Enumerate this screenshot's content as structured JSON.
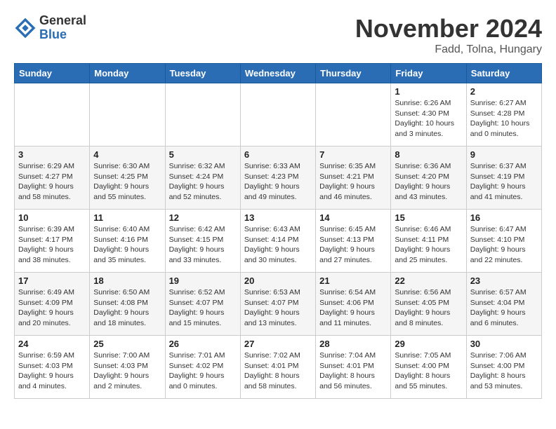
{
  "header": {
    "logo_general": "General",
    "logo_blue": "Blue",
    "month_title": "November 2024",
    "subtitle": "Fadd, Tolna, Hungary"
  },
  "weekdays": [
    "Sunday",
    "Monday",
    "Tuesday",
    "Wednesday",
    "Thursday",
    "Friday",
    "Saturday"
  ],
  "weeks": [
    [
      {
        "day": "",
        "info": ""
      },
      {
        "day": "",
        "info": ""
      },
      {
        "day": "",
        "info": ""
      },
      {
        "day": "",
        "info": ""
      },
      {
        "day": "",
        "info": ""
      },
      {
        "day": "1",
        "info": "Sunrise: 6:26 AM\nSunset: 4:30 PM\nDaylight: 10 hours\nand 3 minutes."
      },
      {
        "day": "2",
        "info": "Sunrise: 6:27 AM\nSunset: 4:28 PM\nDaylight: 10 hours\nand 0 minutes."
      }
    ],
    [
      {
        "day": "3",
        "info": "Sunrise: 6:29 AM\nSunset: 4:27 PM\nDaylight: 9 hours\nand 58 minutes."
      },
      {
        "day": "4",
        "info": "Sunrise: 6:30 AM\nSunset: 4:25 PM\nDaylight: 9 hours\nand 55 minutes."
      },
      {
        "day": "5",
        "info": "Sunrise: 6:32 AM\nSunset: 4:24 PM\nDaylight: 9 hours\nand 52 minutes."
      },
      {
        "day": "6",
        "info": "Sunrise: 6:33 AM\nSunset: 4:23 PM\nDaylight: 9 hours\nand 49 minutes."
      },
      {
        "day": "7",
        "info": "Sunrise: 6:35 AM\nSunset: 4:21 PM\nDaylight: 9 hours\nand 46 minutes."
      },
      {
        "day": "8",
        "info": "Sunrise: 6:36 AM\nSunset: 4:20 PM\nDaylight: 9 hours\nand 43 minutes."
      },
      {
        "day": "9",
        "info": "Sunrise: 6:37 AM\nSunset: 4:19 PM\nDaylight: 9 hours\nand 41 minutes."
      }
    ],
    [
      {
        "day": "10",
        "info": "Sunrise: 6:39 AM\nSunset: 4:17 PM\nDaylight: 9 hours\nand 38 minutes."
      },
      {
        "day": "11",
        "info": "Sunrise: 6:40 AM\nSunset: 4:16 PM\nDaylight: 9 hours\nand 35 minutes."
      },
      {
        "day": "12",
        "info": "Sunrise: 6:42 AM\nSunset: 4:15 PM\nDaylight: 9 hours\nand 33 minutes."
      },
      {
        "day": "13",
        "info": "Sunrise: 6:43 AM\nSunset: 4:14 PM\nDaylight: 9 hours\nand 30 minutes."
      },
      {
        "day": "14",
        "info": "Sunrise: 6:45 AM\nSunset: 4:13 PM\nDaylight: 9 hours\nand 27 minutes."
      },
      {
        "day": "15",
        "info": "Sunrise: 6:46 AM\nSunset: 4:11 PM\nDaylight: 9 hours\nand 25 minutes."
      },
      {
        "day": "16",
        "info": "Sunrise: 6:47 AM\nSunset: 4:10 PM\nDaylight: 9 hours\nand 22 minutes."
      }
    ],
    [
      {
        "day": "17",
        "info": "Sunrise: 6:49 AM\nSunset: 4:09 PM\nDaylight: 9 hours\nand 20 minutes."
      },
      {
        "day": "18",
        "info": "Sunrise: 6:50 AM\nSunset: 4:08 PM\nDaylight: 9 hours\nand 18 minutes."
      },
      {
        "day": "19",
        "info": "Sunrise: 6:52 AM\nSunset: 4:07 PM\nDaylight: 9 hours\nand 15 minutes."
      },
      {
        "day": "20",
        "info": "Sunrise: 6:53 AM\nSunset: 4:07 PM\nDaylight: 9 hours\nand 13 minutes."
      },
      {
        "day": "21",
        "info": "Sunrise: 6:54 AM\nSunset: 4:06 PM\nDaylight: 9 hours\nand 11 minutes."
      },
      {
        "day": "22",
        "info": "Sunrise: 6:56 AM\nSunset: 4:05 PM\nDaylight: 9 hours\nand 8 minutes."
      },
      {
        "day": "23",
        "info": "Sunrise: 6:57 AM\nSunset: 4:04 PM\nDaylight: 9 hours\nand 6 minutes."
      }
    ],
    [
      {
        "day": "24",
        "info": "Sunrise: 6:59 AM\nSunset: 4:03 PM\nDaylight: 9 hours\nand 4 minutes."
      },
      {
        "day": "25",
        "info": "Sunrise: 7:00 AM\nSunset: 4:03 PM\nDaylight: 9 hours\nand 2 minutes."
      },
      {
        "day": "26",
        "info": "Sunrise: 7:01 AM\nSunset: 4:02 PM\nDaylight: 9 hours\nand 0 minutes."
      },
      {
        "day": "27",
        "info": "Sunrise: 7:02 AM\nSunset: 4:01 PM\nDaylight: 8 hours\nand 58 minutes."
      },
      {
        "day": "28",
        "info": "Sunrise: 7:04 AM\nSunset: 4:01 PM\nDaylight: 8 hours\nand 56 minutes."
      },
      {
        "day": "29",
        "info": "Sunrise: 7:05 AM\nSunset: 4:00 PM\nDaylight: 8 hours\nand 55 minutes."
      },
      {
        "day": "30",
        "info": "Sunrise: 7:06 AM\nSunset: 4:00 PM\nDaylight: 8 hours\nand 53 minutes."
      }
    ]
  ]
}
